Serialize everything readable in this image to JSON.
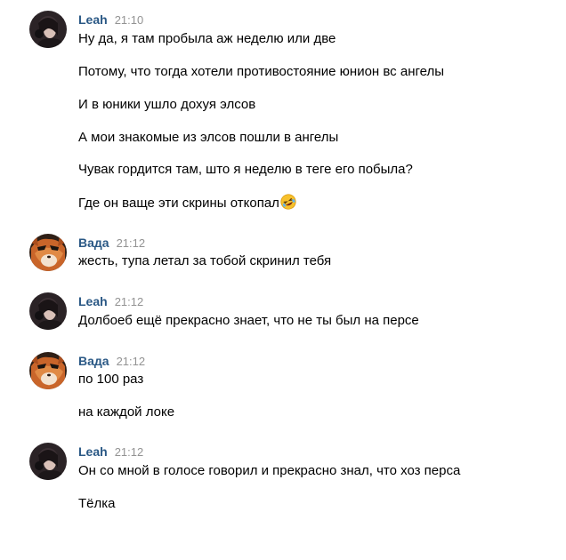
{
  "messages": [
    {
      "author": "Leah",
      "time": "21:10",
      "avatar": "leah-avatar",
      "lines": [
        "Ну да, я там пробыла аж неделю или две",
        "Потому, что тогда хотели противостояние юнион вс ангелы",
        "И в юники ушло дохуя элсов",
        "А мои знакомые из элсов пошли в ангелы",
        "Чувак гордится там, што я неделю в теге его побыла?",
        "Где он ваще эти скрины откопал"
      ],
      "trailing_emoji": "rolling-on-floor-laughing-emoji"
    },
    {
      "author": "Вада",
      "time": "21:12",
      "avatar": "vada-avatar",
      "lines": [
        "жесть, тупа летал за тобой скринил тебя"
      ]
    },
    {
      "author": "Leah",
      "time": "21:12",
      "avatar": "leah-avatar",
      "lines": [
        "Долбоеб ещё прекрасно знает, что не ты был на персе"
      ]
    },
    {
      "author": "Вада",
      "time": "21:12",
      "avatar": "vada-avatar",
      "lines": [
        "по 100 раз",
        "на каждой локе"
      ]
    },
    {
      "author": "Leah",
      "time": "21:12",
      "avatar": "leah-avatar",
      "lines": [
        "Он со мной в голосе говорил и прекрасно знал, что хоз перса",
        "Тёлка"
      ]
    }
  ],
  "colors": {
    "author": "#2a5885",
    "time": "#939393",
    "text": "#000000",
    "background": "#ffffff"
  }
}
